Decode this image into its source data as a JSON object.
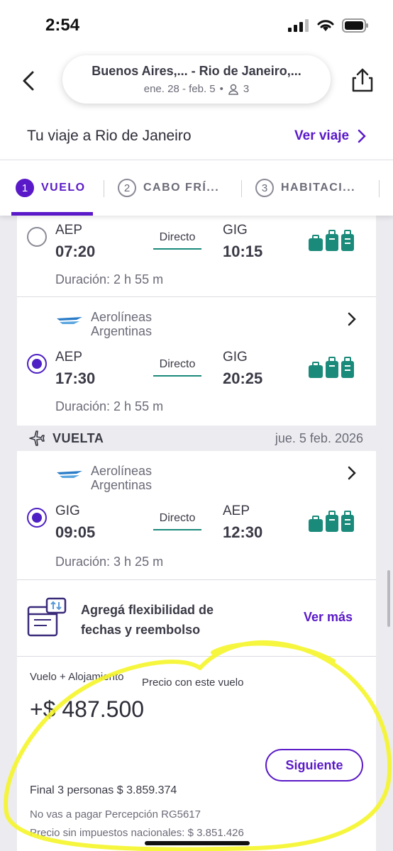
{
  "status": {
    "time": "2:54"
  },
  "header": {
    "route": "Buenos Aires,...  - Rio de Janeiro,...",
    "dates": "ene. 28 -  feb. 5",
    "separator": "•",
    "passengers": "3"
  },
  "trip": {
    "title": "Tu viaje a Rio de Janeiro",
    "link": "Ver viaje"
  },
  "steps": [
    {
      "num": "1",
      "label": "VUELO"
    },
    {
      "num": "2",
      "label": "CABO FRÍ..."
    },
    {
      "num": "3",
      "label": "HABITACI..."
    }
  ],
  "flights": [
    {
      "from_code": "AEP",
      "from_time": "07:20",
      "type": "Directo",
      "to_code": "GIG",
      "to_time": "10:15",
      "duration": "Duración: 2 h 55 m",
      "selected": false
    },
    {
      "airline": "Aerolíneas Argentinas",
      "from_code": "AEP",
      "from_time": "17:30",
      "type": "Directo",
      "to_code": "GIG",
      "to_time": "20:25",
      "duration": "Duración: 2 h 55 m",
      "selected": true
    },
    {
      "airline": "Aerolíneas Argentinas",
      "from_code": "GIG",
      "from_time": "09:05",
      "type": "Directo",
      "to_code": "AEP",
      "to_time": "12:30",
      "duration": "Duración: 3 h 25 m",
      "selected": true
    }
  ],
  "return": {
    "label": "VUELTA",
    "date": "jue. 5 feb. 2026"
  },
  "flex": {
    "line1": "Agregá flexibilidad de",
    "line2": "fechas y reembolso",
    "link": "Ver más"
  },
  "price": {
    "label": "Vuelo + Alojamiento",
    "sublabel": "Precio con este vuelo",
    "amount": "+$ 487.500",
    "next_button": "Siguiente",
    "final": "Final 3 personas  $  3.859.374",
    "note1": "No vas a pagar Percepción RG5617",
    "note2": "Precio sin impuestos nacionales: $ 3.851.426"
  },
  "colors": {
    "accent": "#5a19c8",
    "radio": "#4d1fc4",
    "teal": "#1a8a7a",
    "highlight": "#f5f52a"
  },
  "icons": [
    "back-chevron-icon",
    "share-icon",
    "chevron-right-icon",
    "airline-logo-icon",
    "luggage-icon",
    "plane-icon",
    "calendar-swap-icon",
    "person-icon"
  ]
}
